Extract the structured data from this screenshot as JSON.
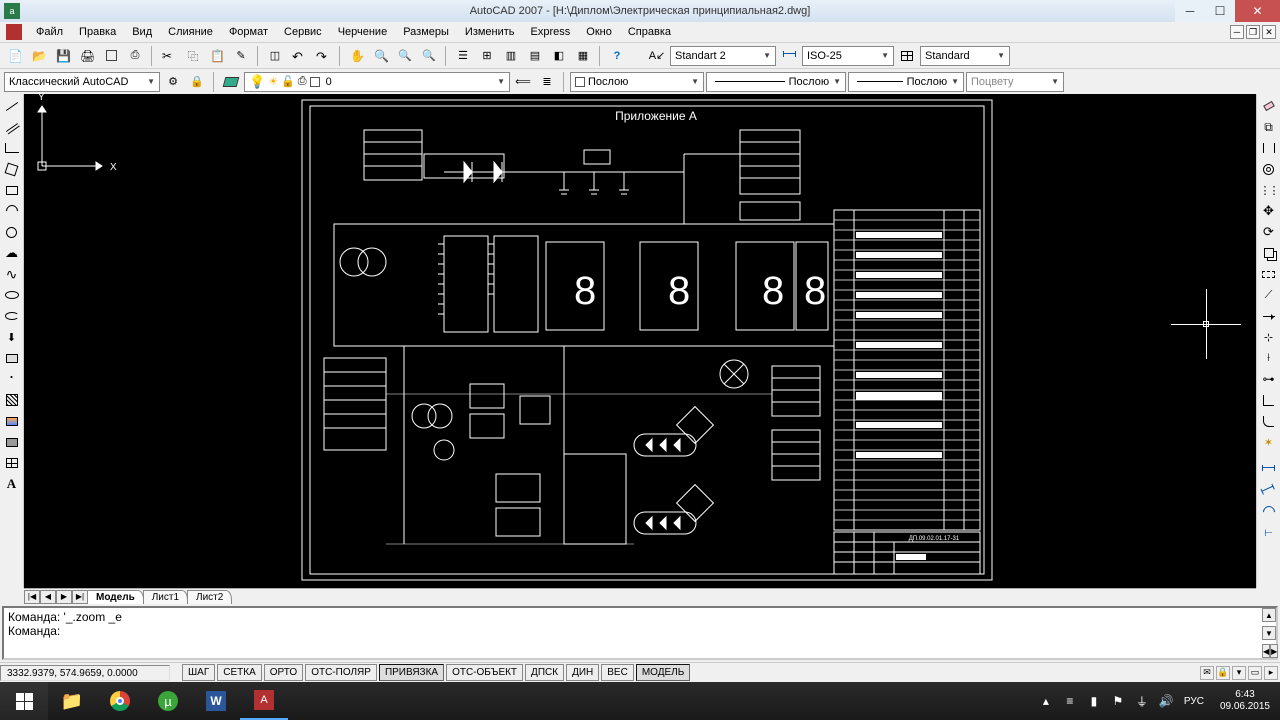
{
  "title": "AutoCAD 2007 - [H:\\Диплом\\Электрическая принципиальная2.dwg]",
  "app_icon_text": "ad",
  "menu": [
    "Файл",
    "Правка",
    "Вид",
    "Слияние",
    "Формат",
    "Сервис",
    "Черчение",
    "Размеры",
    "Изменить",
    "Express",
    "Окно",
    "Справка"
  ],
  "toolbar1": {
    "workspace_label": "Классический AutoCAD",
    "text_style": "Standart 2",
    "dim_style": "ISO-25",
    "table_style": "Standard"
  },
  "toolbar2": {
    "layer_value": "0",
    "color_label": "Послою",
    "linetype_label": "Послою",
    "lineweight_label": "Послою",
    "plot_style": "Поцвету"
  },
  "drawing": {
    "title_text": "Приложение А",
    "title_block_code": "ДП.09.02.01.17-31",
    "ucs_x": "X",
    "ucs_y": "Y"
  },
  "tabs": {
    "model": "Модель",
    "sheet1": "Лист1",
    "sheet2": "Лист2"
  },
  "cmd": {
    "line1": "",
    "line2": "Команда: '_.zoom _e",
    "prompt": "Команда:"
  },
  "status": {
    "coords": "3332.9379, 574.9659, 0.0000",
    "buttons": [
      "ШАГ",
      "СЕТКА",
      "ОРТО",
      "ОТС-ПОЛЯР",
      "ПРИВЯЗКА",
      "ОТС-ОБЪЕКТ",
      "ДПСК",
      "ДИН",
      "ВЕС",
      "МОДЕЛЬ"
    ]
  },
  "systray": {
    "lang": "РУС",
    "time": "6:43",
    "date": "09.06.2015"
  }
}
